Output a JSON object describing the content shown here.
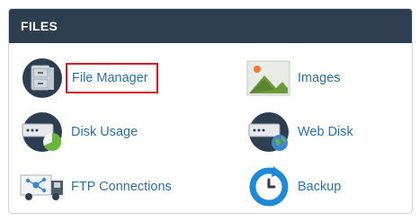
{
  "panel": {
    "title": "FILES",
    "items": [
      {
        "label": "File Manager",
        "icon": "file-cabinet-icon"
      },
      {
        "label": "Images",
        "icon": "image-icon"
      },
      {
        "label": "Disk Usage",
        "icon": "disk-usage-icon"
      },
      {
        "label": "Web Disk",
        "icon": "web-disk-icon"
      },
      {
        "label": "FTP Connections",
        "icon": "ftp-truck-icon"
      },
      {
        "label": "Backup",
        "icon": "backup-icon"
      }
    ]
  },
  "colors": {
    "header_bg": "#2d3e50",
    "link": "#2f6fa7",
    "highlight_box": "#e0141e"
  }
}
